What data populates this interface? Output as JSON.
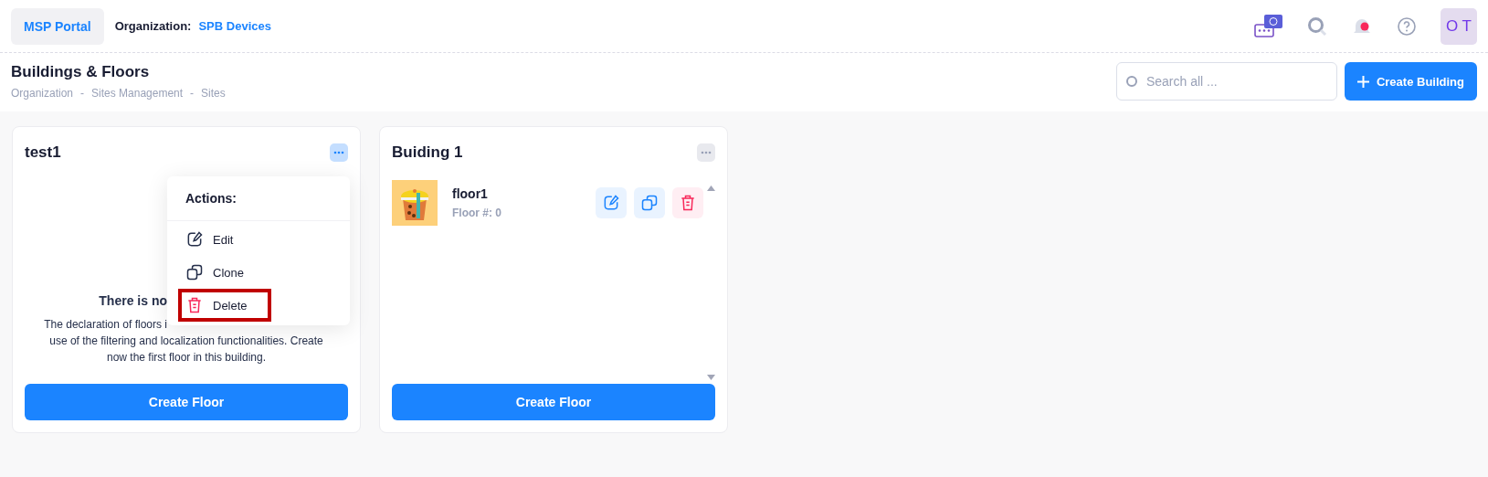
{
  "header": {
    "portal": "MSP Portal",
    "org_label": "Organization:",
    "org_name": "SPB Devices",
    "avatar": "O T",
    "notification_dot": true
  },
  "page": {
    "title": "Buildings & Floors",
    "breadcrumb": [
      "Organization",
      "Sites Management",
      "Sites"
    ],
    "separator": "-",
    "search": {
      "placeholder": "Search all ..."
    },
    "create_button": "Create Building"
  },
  "buildings": [
    {
      "name": "test1",
      "menu_open": true,
      "empty": {
        "title": "There is no",
        "lines": [
          "The declaration of floors i",
          "use of the filtering and localization functionalities. Create",
          "now the first floor in this building."
        ]
      },
      "button": "Create Floor",
      "menu": {
        "title": "Actions:",
        "items": [
          {
            "kind": "edit",
            "label": "Edit",
            "highlighted": false
          },
          {
            "kind": "clone",
            "label": "Clone",
            "highlighted": false
          },
          {
            "kind": "delete",
            "label": "Delete",
            "highlighted": true
          }
        ]
      }
    },
    {
      "name": "Buiding 1",
      "menu_open": false,
      "floors": [
        {
          "name": "floor1",
          "number": "Floor #: 0"
        }
      ],
      "button": "Create Floor"
    }
  ]
}
